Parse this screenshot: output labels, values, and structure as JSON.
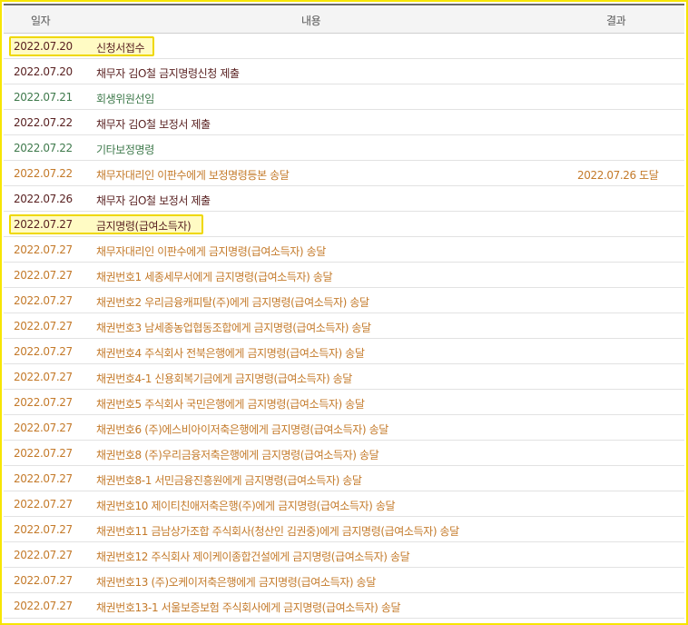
{
  "header": {
    "date": "일자",
    "content": "내용",
    "result": "결과"
  },
  "rows": [
    {
      "date": "2022.07.20",
      "content": "신청서접수",
      "result": "",
      "tone": "dark"
    },
    {
      "date": "2022.07.20",
      "content": "채무자 김O철 금지명령신청 제출",
      "result": "",
      "tone": "dark"
    },
    {
      "date": "2022.07.21",
      "content": "회생위원선임",
      "result": "",
      "tone": "green"
    },
    {
      "date": "2022.07.22",
      "content": "채무자 김O철 보정서 제출",
      "result": "",
      "tone": "dark"
    },
    {
      "date": "2022.07.22",
      "content": "기타보정명령",
      "result": "",
      "tone": "green"
    },
    {
      "date": "2022.07.22",
      "content": "채무자대리인 이판수에게 보정명령등본 송달",
      "result": "2022.07.26 도달",
      "tone": "orange"
    },
    {
      "date": "2022.07.26",
      "content": "채무자 김O철 보정서 제출",
      "result": "",
      "tone": "dark"
    },
    {
      "date": "2022.07.27",
      "content": "금지명령(급여소득자)",
      "result": "",
      "tone": "dark"
    },
    {
      "date": "2022.07.27",
      "content": "채무자대리인 이판수에게 금지명령(급여소득자) 송달",
      "result": "",
      "tone": "orange"
    },
    {
      "date": "2022.07.27",
      "content": "채권번호1 세종세무서에게 금지명령(급여소득자) 송달",
      "result": "",
      "tone": "orange"
    },
    {
      "date": "2022.07.27",
      "content": "채권번호2 우리금융캐피탈(주)에게 금지명령(급여소득자) 송달",
      "result": "",
      "tone": "orange"
    },
    {
      "date": "2022.07.27",
      "content": "채권번호3 남세종농업협동조합에게 금지명령(급여소득자) 송달",
      "result": "",
      "tone": "orange"
    },
    {
      "date": "2022.07.27",
      "content": "채권번호4 주식회사 전북은행에게 금지명령(급여소득자) 송달",
      "result": "",
      "tone": "orange"
    },
    {
      "date": "2022.07.27",
      "content": "채권번호4-1 신용회복기금에게 금지명령(급여소득자) 송달",
      "result": "",
      "tone": "orange"
    },
    {
      "date": "2022.07.27",
      "content": "채권번호5 주식회사 국민은행에게 금지명령(급여소득자) 송달",
      "result": "",
      "tone": "orange"
    },
    {
      "date": "2022.07.27",
      "content": "채권번호6 (주)에스비아이저축은행에게 금지명령(급여소득자) 송달",
      "result": "",
      "tone": "orange"
    },
    {
      "date": "2022.07.27",
      "content": "채권번호8 (주)우리금융저축은행에게 금지명령(급여소득자) 송달",
      "result": "",
      "tone": "orange"
    },
    {
      "date": "2022.07.27",
      "content": "채권번호8-1 서민금융진흥원에게 금지명령(급여소득자) 송달",
      "result": "",
      "tone": "orange"
    },
    {
      "date": "2022.07.27",
      "content": "채권번호10 제이티친애저축은행(주)에게 금지명령(급여소득자) 송달",
      "result": "",
      "tone": "orange"
    },
    {
      "date": "2022.07.27",
      "content": "채권번호11 금남상가조합 주식회사(청산인 김권중)에게 금지명령(급여소득자) 송달",
      "result": "",
      "tone": "orange"
    },
    {
      "date": "2022.07.27",
      "content": "채권번호12 주식회사 제이케이종합건설에게 금지명령(급여소득자) 송달",
      "result": "",
      "tone": "orange"
    },
    {
      "date": "2022.07.27",
      "content": "채권번호13 (주)오케이저축은행에게 금지명령(급여소득자) 송달",
      "result": "",
      "tone": "orange"
    },
    {
      "date": "2022.07.27",
      "content": "채권번호13-1 서울보증보험 주식회사에게 금지명령(급여소득자) 송달",
      "result": "",
      "tone": "orange"
    }
  ],
  "highlighted_rows": [
    0,
    7
  ],
  "colors": {
    "dark": "#5a2222",
    "green": "#3f7a4c",
    "orange": "#c47a2a",
    "highlight_border": "#efd800",
    "frame": "#f7e500"
  }
}
